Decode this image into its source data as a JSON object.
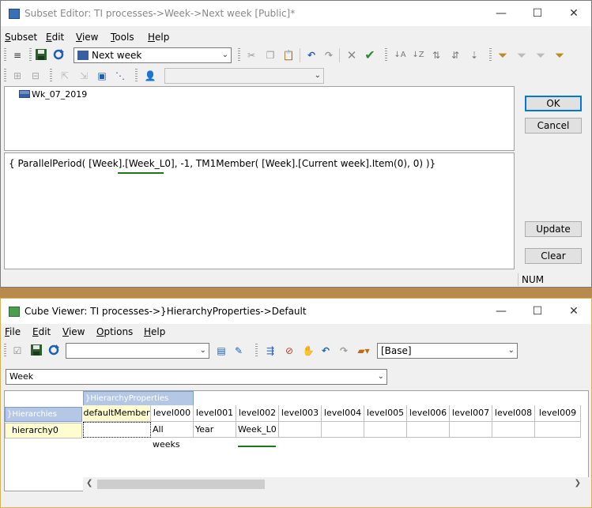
{
  "subset_editor": {
    "title": "Subset Editor:  TI processes->Week->Next week  [Public]*",
    "menu": [
      "Subset",
      "Edit",
      "View",
      "Tools",
      "Help"
    ],
    "subset_combo": "Next week",
    "members": [
      "Wk_07_2019"
    ],
    "expression": "{ ParallelPeriod( [Week].[Week_L0], -1, TM1Member( [Week].[Current week].Item(0), 0) )}",
    "buttons": {
      "ok": "OK",
      "cancel": "Cancel",
      "update": "Update",
      "clear": "Clear"
    },
    "status": "NUM"
  },
  "cube_viewer": {
    "title": "Cube Viewer: TI processes->}HierarchyProperties->Default",
    "menu": [
      "File",
      "Edit",
      "View",
      "Options",
      "Help"
    ],
    "view_combo": "",
    "base_combo": "[Base]",
    "dimension_combo": "Week",
    "column_dimension": "}HierarchyProperties",
    "row_dimension": "}Hierarchies",
    "columns": [
      "defaultMember",
      "level000",
      "level001",
      "level002",
      "level003",
      "level004",
      "level005",
      "level006",
      "level007",
      "level008",
      "level009"
    ],
    "rows": [
      {
        "label": "hierarchy0",
        "cells": [
          "",
          "All weeks",
          "Year",
          "Week_L0",
          "",
          "",
          "",
          "",
          "",
          "",
          ""
        ]
      }
    ]
  },
  "window_controls": {
    "minimize": "—",
    "maximize": "☐",
    "close": "✕"
  },
  "icons": {
    "save": "floppy-icon",
    "refresh": "refresh-icon",
    "cut": "scissors-icon",
    "paste": "paste-icon",
    "undo": "undo-icon",
    "apply": "checkmark-icon",
    "delete": "x-icon",
    "filter": "filter-icon"
  }
}
